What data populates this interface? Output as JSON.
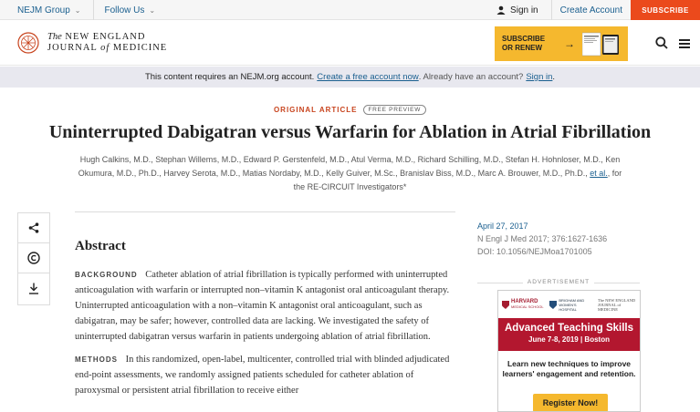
{
  "topbar": {
    "group_label": "NEJM Group",
    "follow_label": "Follow Us",
    "signin_label": "Sign in",
    "create_label": "Create Account",
    "subscribe_label": "SUBSCRIBE"
  },
  "header": {
    "logo_line1_prefix": "The",
    "logo_line1": "NEW ENGLAND",
    "logo_line2_a": "JOURNAL",
    "logo_line2_of": "of",
    "logo_line2_b": "MEDICINE",
    "promo_line1": "SUBSCRIBE",
    "promo_line2": "OR RENEW",
    "promo_arrow": "→"
  },
  "notice": {
    "text": "This content requires an NEJM.org account.",
    "create_link": "Create a free account now",
    "middle": ". Already have an account?",
    "signin_link": "Sign in",
    "end": "."
  },
  "article": {
    "type": "ORIGINAL ARTICLE",
    "access": "FREE PREVIEW",
    "title": "Uninterrupted Dabigatran versus Warfarin for Ablation in Atrial Fibrillation",
    "authors_line1": "Hugh Calkins, M.D., Stephan Willems, M.D., Edward P. Gerstenfeld, M.D., Atul Verma, M.D., Richard Schilling, M.D., Stefan H. Hohnloser, M.D., Ken",
    "authors_line2a": "Okumura, M.D., Ph.D., Harvey Serota, M.D., Matias Nordaby, M.D., Kelly Guiver, M.Sc., Branislav Biss, M.D., Marc A. Brouwer, M.D., Ph.D., ",
    "authors_etal": "et al.",
    "authors_line2b": ", for",
    "authors_line3": "the RE-CIRCUIT Investigators*"
  },
  "abstract": {
    "heading": "Abstract",
    "background_label": "BACKGROUND",
    "background_text": "Catheter ablation of atrial fibrillation is typically performed with uninterrupted anticoagulation with warfarin or interrupted non–vitamin K antagonist oral anticoagulant therapy. Uninterrupted anticoagulation with a non–vitamin K antagonist oral anticoagulant, such as dabigatran, may be safer; however, controlled data are lacking. We investigated the safety of uninterrupted dabigatran versus warfarin in patients undergoing ablation of atrial fibrillation.",
    "methods_label": "METHODS",
    "methods_text": "In this randomized, open-label, multicenter, controlled trial with blinded adjudicated end-point assessments, we randomly assigned patients scheduled for catheter ablation of paroxysmal or persistent atrial fibrillation to receive either"
  },
  "meta": {
    "date": "April 27, 2017",
    "citation": "N Engl J Med 2017; 376:1627-1636",
    "doi": "DOI: 10.1056/NEJMoa1701005"
  },
  "ad": {
    "label": "ADVERTISEMENT",
    "harvard": "HARVARD",
    "harvard_sub": "MEDICAL SCHOOL",
    "bwh": "BRIGHAM AND WOMEN'S HOSPITAL",
    "nejm": "The NEW ENGLAND JOURNAL of MEDICINE",
    "title": "Advanced Teaching Skills",
    "subtitle": "June 7-8, 2019 | Boston",
    "copy": "Learn new techniques to improve learners' engagement and retention.",
    "button": "Register Now!"
  },
  "colors": {
    "link": "#1a5f8f",
    "subscribe": "#eb4a1c",
    "promo": "#f5b82e",
    "accent_red": "#c8441e",
    "ad_banner": "#b3172f"
  }
}
